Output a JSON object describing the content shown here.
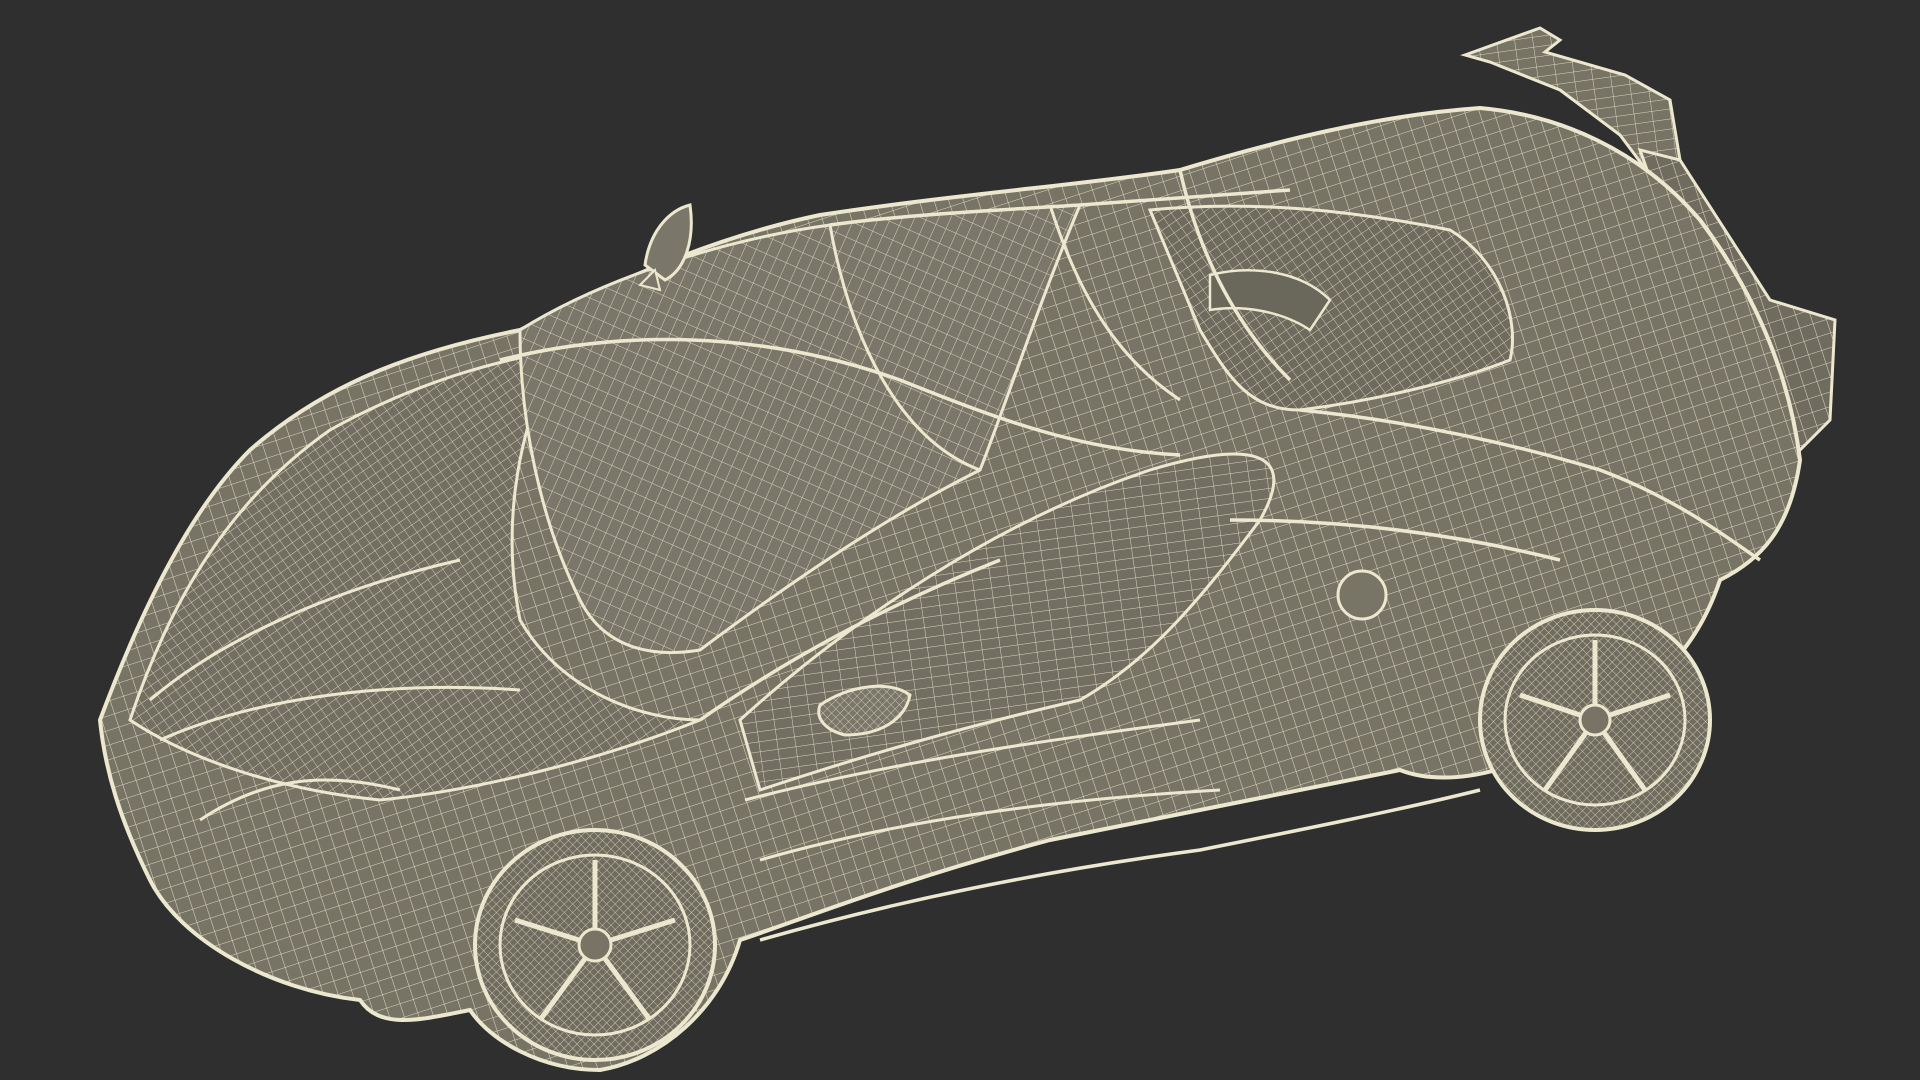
{
  "scene": {
    "background_color": "#2f2f2f",
    "body_fill_color": "#777466",
    "body_fill_shadow_color": "#5f5d52",
    "wire_color": "#ece8cf",
    "subject": "wireframe-sports-car-render"
  }
}
